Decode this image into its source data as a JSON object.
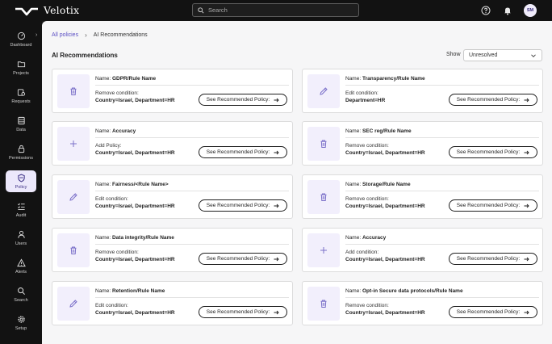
{
  "app": {
    "logo_text": "Velotix",
    "search_placeholder": "Search",
    "user_initials": "SM"
  },
  "sidebar": {
    "items": [
      {
        "label": "Dashboard",
        "icon": "dashboard-icon"
      },
      {
        "label": "Projects",
        "icon": "folder-icon"
      },
      {
        "label": "Requests",
        "icon": "requests-icon"
      },
      {
        "label": "Data",
        "icon": "database-icon"
      },
      {
        "label": "Permissions",
        "icon": "lock-icon"
      },
      {
        "label": "Policy",
        "icon": "shield-icon",
        "active": true
      },
      {
        "label": "Audit",
        "icon": "audit-list-icon"
      },
      {
        "label": "Users",
        "icon": "user-icon"
      },
      {
        "label": "Alerts",
        "icon": "warning-icon"
      },
      {
        "label": "Search",
        "icon": "search-icon"
      },
      {
        "label": "Setup",
        "icon": "gear-icon"
      }
    ]
  },
  "breadcrumb": {
    "parent": "All policies",
    "current": "AI Recommendations"
  },
  "page": {
    "title": "AI Recommendations",
    "show_label": "Show",
    "show_value": "Unresolved"
  },
  "cards": [
    {
      "icon": "trash-icon",
      "name_prefix": "Name:",
      "name": "GDPR/Rule Name",
      "action": "Remove condition:",
      "condition": "Country=Israel, Department=HR",
      "button": "See Recommended Policy:"
    },
    {
      "icon": "pencil-icon",
      "name_prefix": "Name:",
      "name": "Transparency/Rule Name",
      "action": "Edit condition:",
      "condition": "Department=HR",
      "button": "See Recommended Policy:"
    },
    {
      "icon": "plus-icon",
      "name_prefix": "Name:",
      "name": "Accuracy",
      "action": "Add Policy:",
      "condition": "Country=Israel, Department=HR",
      "button": "See Recommended Policy:"
    },
    {
      "icon": "trash-icon",
      "name_prefix": "Name:",
      "name": "SEC reg/Rule Name",
      "action": "Remove condition:",
      "condition": "Country=Israel, Department=HR",
      "button": "See Recommended Policy:"
    },
    {
      "icon": "pencil-icon",
      "name_prefix": "Name:",
      "name": "Fairness/<Rule Name>",
      "action": "Edit condition:",
      "condition": "Country=Israel, Department=HR",
      "button": "See Recommended Policy:"
    },
    {
      "icon": "trash-icon",
      "name_prefix": "Name:",
      "name": "Storage/Rule Name",
      "action": "Remove condition:",
      "condition": "Country=Israel, Department=HR",
      "button": "See Recommended Policy:"
    },
    {
      "icon": "trash-icon",
      "name_prefix": "Name:",
      "name": "Data integrity/Rule Name",
      "action": "Remove condition:",
      "condition": "Country=Israel, Department=HR",
      "button": "See Recommended Policy:"
    },
    {
      "icon": "plus-icon",
      "name_prefix": "Name:",
      "name": "Accuracy",
      "action": "Add condition:",
      "condition": "Country=Israel, Department=HR",
      "button": "See Recommended Policy:"
    },
    {
      "icon": "pencil-icon",
      "name_prefix": "Name:",
      "name": "Retention/Rule Name",
      "action": "Edit condition:",
      "condition": "Country=Israel, Department=HR",
      "button": "See Recommended Policy:"
    },
    {
      "icon": "trash-icon",
      "name_prefix": "Name:",
      "name": "Opt-in Secure data protocols/Rule Name",
      "action": "Remove condition:",
      "condition": "Country=Israel, Department=HR",
      "button": "See Recommended Policy:"
    }
  ],
  "colors": {
    "accent": "#5b4fc4",
    "icon_bg": "#f2effc",
    "sidebar_bg": "#121212"
  }
}
